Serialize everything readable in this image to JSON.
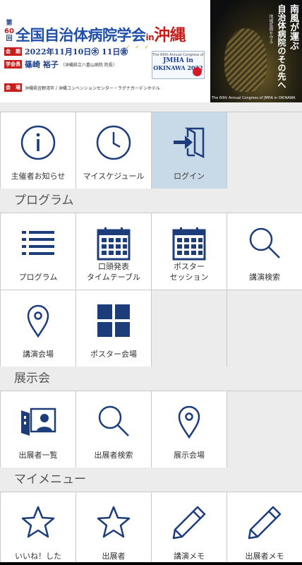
{
  "banner": {
    "dai": "第",
    "number": "60",
    "kai": "回",
    "title": "全国自治体病院学会",
    "in": "in",
    "place": "沖縄",
    "date_tag": "会　期",
    "date": "2022年11月10日㊍ 11日㊎",
    "president_tag": "学会長",
    "president": "篠崎 裕子",
    "president_note": "（沖縄県立八重山病院 院長）",
    "venue_tag": "会　場",
    "venue": "沖縄県宜野湾市 / 沖縄コンベンションセンター・ラグナガーデンホテル",
    "jmha_line1": "The 60th Annual Congress of",
    "jmha_line2": "JMHA in",
    "jmha_line3": "OKINAWA 2022",
    "right_text1": "南風が運ぶ",
    "right_text2": "自治体病院のその先へ",
    "right_text3": "地域医療を守る",
    "right_caption": "The 60th Annual Congress of JMHA in OKINAWA"
  },
  "top_menu": [
    {
      "label": "主催者お知らせ",
      "icon": "info-icon"
    },
    {
      "label": "マイスケジュール",
      "icon": "clock-icon"
    },
    {
      "label": "ログイン",
      "icon": "login-icon"
    }
  ],
  "sections": {
    "program": {
      "title": "プログラム",
      "items": [
        {
          "label": "プログラム",
          "icon": "list-icon"
        },
        {
          "label": "口頭発表\nタイムテーブル",
          "icon": "calendar-icon"
        },
        {
          "label": "ポスター\nセッション",
          "icon": "calendar-icon"
        },
        {
          "label": "講演検索",
          "icon": "search-icon"
        },
        {
          "label": "講演会場",
          "icon": "map-pin-icon"
        },
        {
          "label": "ポスター会場",
          "icon": "grid-icon"
        }
      ]
    },
    "exhibition": {
      "title": "展示会",
      "items": [
        {
          "label": "出展者一覧",
          "icon": "exhibitor-icon"
        },
        {
          "label": "出展者検索",
          "icon": "search-icon"
        },
        {
          "label": "展示会場",
          "icon": "map-pin-icon"
        }
      ]
    },
    "mymenu": {
      "title": "マイメニュー",
      "items": [
        {
          "label": "いいね！した",
          "icon": "star-icon"
        },
        {
          "label": "出展者",
          "icon": "star-icon"
        },
        {
          "label": "講演メモ",
          "icon": "pencil-icon"
        },
        {
          "label": "出展者メモ",
          "icon": "pencil-icon"
        }
      ]
    }
  },
  "colors": {
    "icon": "#1c3d7a",
    "active_tile": "#c8dae8",
    "brand_blue": "#1f4fa8",
    "brand_red": "#c61d1d"
  }
}
